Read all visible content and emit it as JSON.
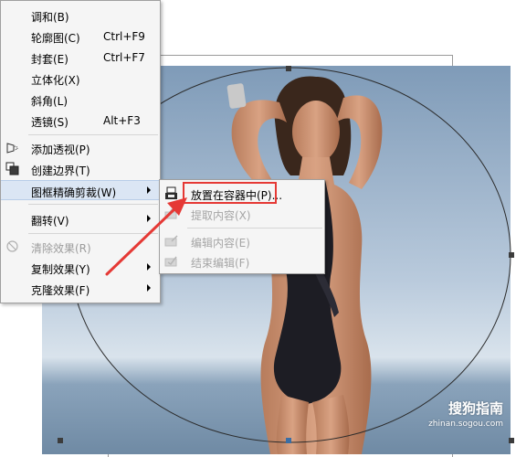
{
  "menu": {
    "items": [
      {
        "label": "调和(B)",
        "shortcut": "",
        "submenu": false,
        "disabled": false
      },
      {
        "label": "轮廓图(C)",
        "shortcut": "Ctrl+F9",
        "submenu": false,
        "disabled": false
      },
      {
        "label": "封套(E)",
        "shortcut": "Ctrl+F7",
        "submenu": false,
        "disabled": false
      },
      {
        "label": "立体化(X)",
        "shortcut": "",
        "submenu": false,
        "disabled": false
      },
      {
        "label": "斜角(L)",
        "shortcut": "",
        "submenu": false,
        "disabled": false
      },
      {
        "label": "透镜(S)",
        "shortcut": "Alt+F3",
        "submenu": false,
        "disabled": false
      },
      {
        "label": "添加透视(P)",
        "shortcut": "",
        "submenu": false,
        "disabled": false,
        "icon": "perspective-icon"
      },
      {
        "label": "创建边界(T)",
        "shortcut": "",
        "submenu": false,
        "disabled": false,
        "icon": "boundary-icon"
      },
      {
        "label": "图框精确剪裁(W)",
        "shortcut": "",
        "submenu": true,
        "disabled": false,
        "highlighted": true
      },
      {
        "label": "翻转(V)",
        "shortcut": "",
        "submenu": true,
        "disabled": false
      },
      {
        "label": "清除效果(R)",
        "shortcut": "",
        "submenu": false,
        "disabled": true,
        "icon": "clear-effect-icon"
      },
      {
        "label": "复制效果(Y)",
        "shortcut": "",
        "submenu": true,
        "disabled": false
      },
      {
        "label": "克隆效果(F)",
        "shortcut": "",
        "submenu": true,
        "disabled": false
      }
    ]
  },
  "submenu": {
    "items": [
      {
        "label": "放置在容器中(P)...",
        "disabled": false,
        "icon": "place-in-container-icon"
      },
      {
        "label": "提取内容(X)",
        "disabled": true,
        "icon": "extract-content-icon"
      },
      {
        "label": "编辑内容(E)",
        "disabled": true,
        "icon": "edit-content-icon"
      },
      {
        "label": "结束编辑(F)",
        "disabled": true,
        "icon": "finish-edit-icon"
      }
    ]
  },
  "watermark": {
    "brand": "搜狗指南",
    "url": "zhinan.sogou.com"
  },
  "colors": {
    "highlight": "#dbe6f4",
    "annotation_red": "#e53935",
    "disabled_text": "#9c9c9c"
  }
}
